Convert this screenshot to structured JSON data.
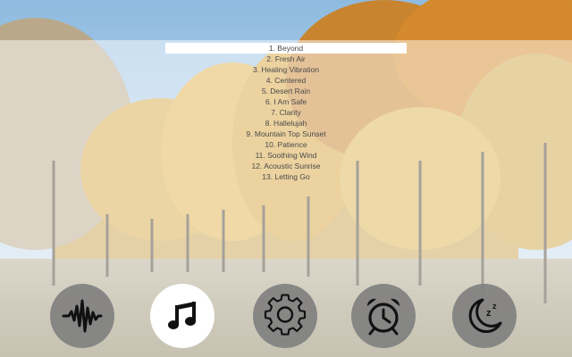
{
  "playlist": {
    "selected_index": 0,
    "tracks": [
      {
        "label": "1. Beyond"
      },
      {
        "label": "2. Fresh Air"
      },
      {
        "label": "3. Healing Vibration"
      },
      {
        "label": "4. Centered"
      },
      {
        "label": "5. Desert Rain"
      },
      {
        "label": "6. I Am Safe"
      },
      {
        "label": "7. Clarity"
      },
      {
        "label": "8. Hallelujah"
      },
      {
        "label": "9. Mountain Top Sunset"
      },
      {
        "label": "10. Patience"
      },
      {
        "label": "11. Soothing Wind"
      },
      {
        "label": "12. Acoustic Sunrise"
      },
      {
        "label": "13. Letting Go"
      }
    ]
  },
  "nav": {
    "active": "music",
    "buttons": [
      {
        "id": "sound",
        "icon": "waveform-icon"
      },
      {
        "id": "music",
        "icon": "music-note-icon"
      },
      {
        "id": "settings",
        "icon": "gear-icon"
      },
      {
        "id": "alarm",
        "icon": "alarm-clock-icon"
      },
      {
        "id": "sleep",
        "icon": "moon-zzz-icon"
      }
    ]
  },
  "colors": {
    "sky": "#9cc3e2",
    "foliage": "#d9a441",
    "nav_button": "#808080",
    "nav_active": "#ffffff",
    "icon": "#111111",
    "track_text": "#4a4a4a"
  }
}
